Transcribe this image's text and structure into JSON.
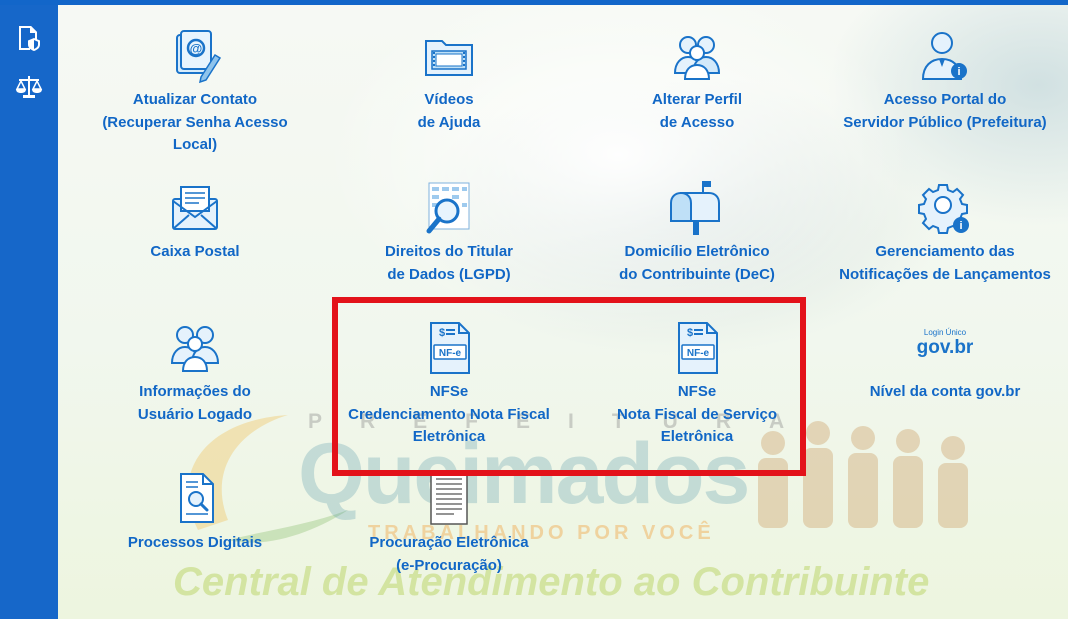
{
  "sidebar": {
    "items": [
      {
        "icon": "document-shield-icon"
      },
      {
        "icon": "scales-icon"
      }
    ]
  },
  "watermark": {
    "prefeitura": "PREFEITURA",
    "logo": "Queimados",
    "slogan": "TRABALHANDO POR VOCÊ",
    "central": "Central de Atendimento ao Contribuinte"
  },
  "tiles": [
    {
      "icon": "contact-email-icon",
      "lines": [
        "Atualizar Contato",
        "(Recuperar Senha Acesso",
        "Local)"
      ]
    },
    {
      "icon": "video-folder-icon",
      "lines": [
        "Vídeos",
        "de Ajuda"
      ]
    },
    {
      "icon": "users-profile-icon",
      "lines": [
        "Alterar Perfil",
        "de Acesso"
      ]
    },
    {
      "icon": "public-servant-icon",
      "lines": [
        "Acesso Portal do",
        "Servidor Público (Prefeitura)"
      ]
    },
    {
      "icon": "mail-envelope-icon",
      "lines": [
        "Caixa Postal"
      ]
    },
    {
      "icon": "data-magnifier-icon",
      "lines": [
        "Direitos do Titular",
        "de Dados (LGPD)"
      ]
    },
    {
      "icon": "mailbox-icon",
      "lines": [
        "Domicílio Eletrônico",
        "do Contribuinte (DeC)"
      ]
    },
    {
      "icon": "gear-info-icon",
      "lines": [
        "Gerenciamento das",
        "Notificações de Lançamentos"
      ]
    },
    {
      "icon": "users-group-icon",
      "lines": [
        "Informações do",
        "Usuário Logado"
      ]
    },
    {
      "icon": "nfe-document-icon",
      "badge": "NF-e",
      "lines": [
        "NFSe",
        "Credenciamento Nota Fiscal",
        "Eletrônica"
      ]
    },
    {
      "icon": "nfe-document-icon",
      "badge": "NF-e",
      "lines": [
        "NFSe",
        "Nota Fiscal de Serviço",
        "Eletrônica"
      ]
    },
    {
      "icon": "govbr-logo-icon",
      "logo_top": "Login Único",
      "logo_main": "gov.br",
      "lines": [
        "Nível da conta gov.br"
      ]
    },
    {
      "icon": "document-search-icon",
      "lines": [
        "Processos Digitais"
      ]
    },
    {
      "icon": "document-lines-icon",
      "lines": [
        "Procuração Eletrônica",
        "(e-Procuração)"
      ]
    }
  ],
  "colors": {
    "primary": "#1266c9",
    "label": "#1167c6",
    "highlight": "#e3121a"
  }
}
